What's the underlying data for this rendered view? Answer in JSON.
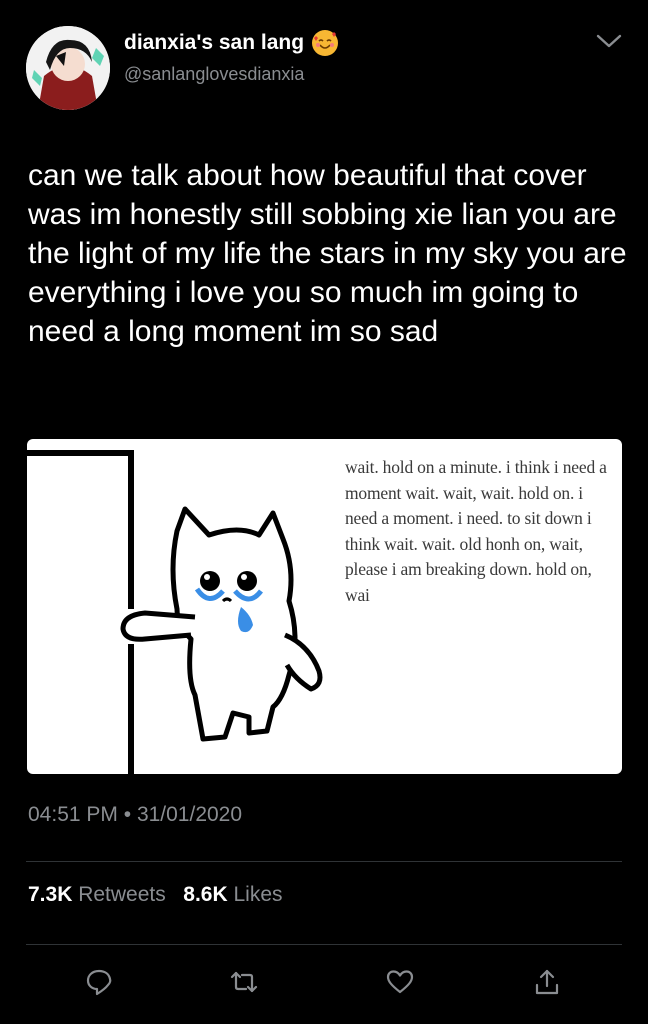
{
  "author": {
    "display_name": "dianxia's san lang",
    "handle": "@sanlanglovesdianxia",
    "avatar_icon": "avatar-image",
    "name_emoji": "smiling-face-with-hearts-icon"
  },
  "tweet": {
    "text": "can we talk about how beautiful that cover was im honestly still sobbing xie lian you are the light of my life the stars in my sky you are everything i love you so much im going to need a long moment im so sad",
    "media_text": "wait. hold on a minute. i think i need a moment wait. wait, wait. hold on. i need a moment. i need. to sit down i think wait. wait. old honh on, wait, please i am breaking down. hold on, wai",
    "time": "04:51 PM",
    "separator": "•",
    "date": "31/01/2020"
  },
  "stats": {
    "retweets_count": "7.3K",
    "retweets_label": "Retweets",
    "likes_count": "8.6K",
    "likes_label": "Likes"
  },
  "actions": {
    "reply_icon": "reply-icon",
    "retweet_icon": "retweet-icon",
    "like_icon": "heart-icon",
    "share_icon": "share-icon",
    "menu_icon": "chevron-down-icon"
  },
  "colors": {
    "background": "#000000",
    "text": "#ffffff",
    "muted": "#8a8d91",
    "divider": "#2f3336",
    "tear": "#3a8ee6"
  }
}
